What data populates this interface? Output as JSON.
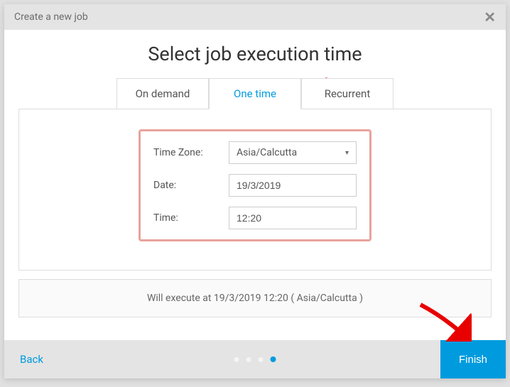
{
  "modal": {
    "title": "Create a new job",
    "heading": "Select job execution time"
  },
  "tabs": {
    "on_demand": "On demand",
    "one_time": "One time",
    "recurrent": "Recurrent"
  },
  "form": {
    "timezone_label": "Time Zone:",
    "timezone_value": "Asia/Calcutta",
    "date_label": "Date:",
    "date_value": "19/3/2019",
    "time_label": "Time:",
    "time_value": "12:20"
  },
  "summary": "Will execute at 19/3/2019 12:20 ( Asia/Calcutta )",
  "footer": {
    "back_label": "Back",
    "finish_label": "Finish"
  }
}
